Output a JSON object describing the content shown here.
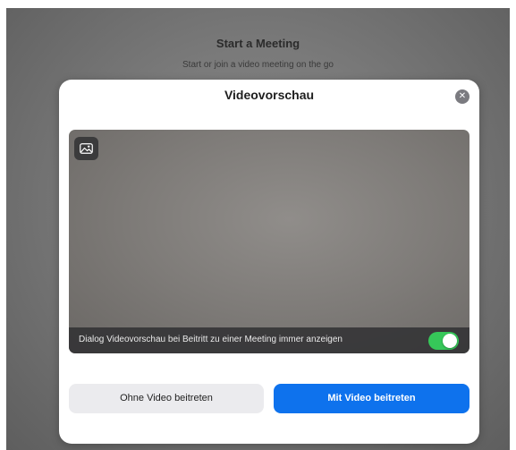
{
  "background": {
    "title": "Start a Meeting",
    "subtitle": "Start or join a video meeting on the go"
  },
  "dialog": {
    "title": "Videovorschau",
    "close_icon": "close-icon",
    "background_image_icon": "image-icon",
    "always_show_label": "Dialog Videovorschau bei Beitritt zu einer Meeting immer anzeigen",
    "always_show_enabled": true,
    "join_without_video_label": "Ohne Video beitreten",
    "join_with_video_label": "Mit Video beitreten"
  },
  "colors": {
    "accent": "#0e72ed",
    "toggle_on": "#36c759"
  }
}
